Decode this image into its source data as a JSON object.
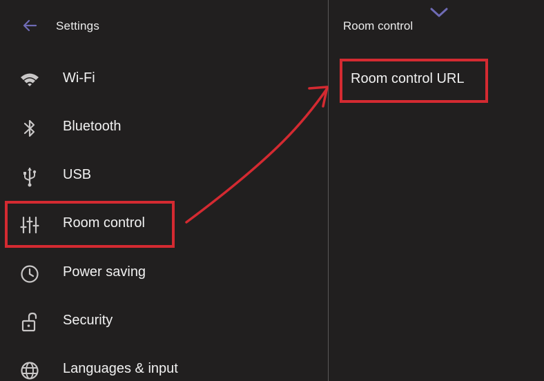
{
  "header": {
    "back_icon": "arrow-left-icon",
    "title": "Settings"
  },
  "menu": {
    "items": [
      {
        "label": "Wi-Fi",
        "icon": "wifi-icon"
      },
      {
        "label": "Bluetooth",
        "icon": "bluetooth-icon"
      },
      {
        "label": "USB",
        "icon": "usb-icon"
      },
      {
        "label": "Room control",
        "icon": "sliders-icon",
        "highlighted": true
      },
      {
        "label": "Power saving",
        "icon": "clock-icon"
      },
      {
        "label": "Security",
        "icon": "unlock-icon"
      },
      {
        "label": "Languages & input",
        "icon": "globe-icon"
      }
    ]
  },
  "detail": {
    "title": "Room control",
    "collapse_icon": "chevron-down-icon",
    "items": [
      {
        "label": "Room control URL",
        "highlighted": true
      }
    ]
  },
  "colors": {
    "background": "#211f1f",
    "text": "#f1f1f1",
    "icon": "#c9c7c7",
    "accent": "#6f6bb5",
    "annotation": "#d42a31"
  }
}
